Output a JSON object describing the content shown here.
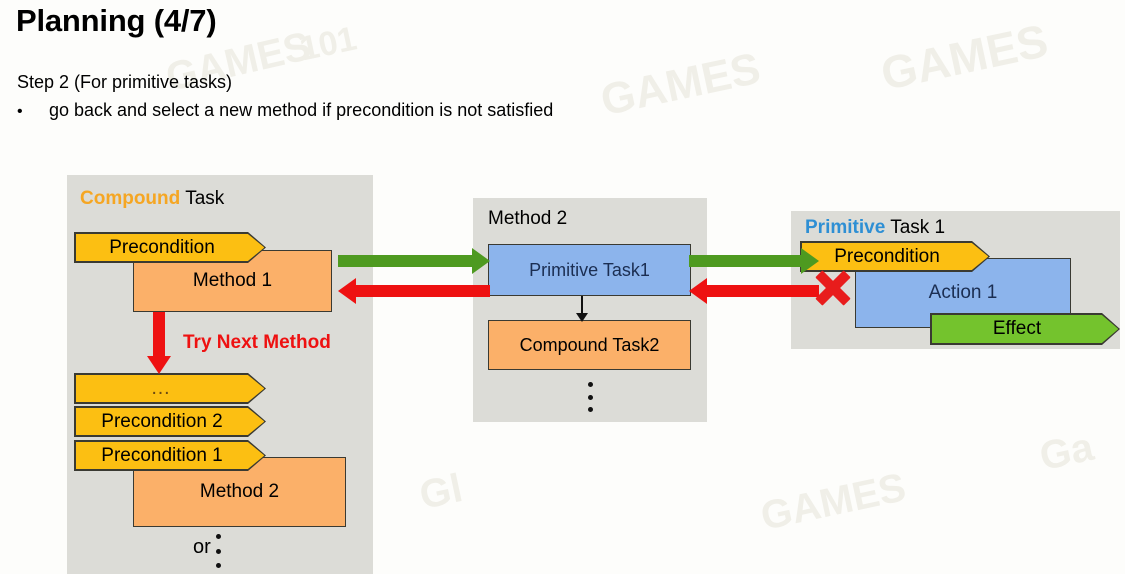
{
  "slide": {
    "title": "Planning (4/7)",
    "step_line": "Step 2 (For primitive tasks)",
    "bullet_marker": "•",
    "bullet_text": "go back and select a new method if precondition is not satisfied"
  },
  "panels": {
    "compound": {
      "title_keyword": "Compound",
      "title_rest": " Task",
      "precondition_top": "Precondition",
      "method_1": "Method 1",
      "try_next_method": "Try Next Method",
      "ellipsis": "…",
      "precondition_2": "Precondition 2",
      "precondition_1": "Precondition 1",
      "method_2": "Method 2",
      "or_label": "or"
    },
    "method2": {
      "title": "Method 2",
      "primitive_task_1": "Primitive Task1",
      "compound_task_2": "Compound Task2"
    },
    "primitive": {
      "title_keyword": "Primitive",
      "title_rest": " Task 1",
      "precondition": "Precondition",
      "action_1": "Action 1",
      "effect": "Effect"
    }
  },
  "arrows": {
    "expand_label": "expand-arrow-green",
    "backtrack_label": "backtrack-arrow-red",
    "fail_marker": "red-cross"
  },
  "colors": {
    "panel_gray": "#dcdcd7",
    "chevron_yellow": "#fcbf12",
    "method_orange": "#fbb069",
    "task_blue": "#8cb4ec",
    "effect_green": "#74c32d",
    "arrow_green": "#4e9a20",
    "arrow_red": "#ee1111",
    "keyword_orange": "#f5a623",
    "keyword_blue": "#2e8fd4",
    "background": "#fdfdfb"
  },
  "watermarks": [
    "GAMES",
    "101",
    "GAMES",
    "GAMES",
    "Gl",
    "Gl",
    "GAMES",
    "Ga"
  ]
}
